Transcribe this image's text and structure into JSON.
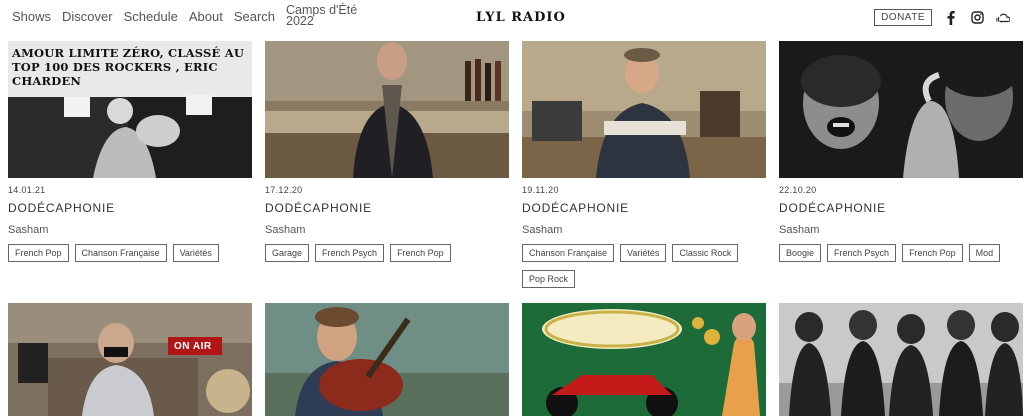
{
  "nav": {
    "shows": "Shows",
    "discover": "Discover",
    "schedule": "Schedule",
    "about": "About",
    "search": "Search",
    "camps": "Camps d'Été 2022"
  },
  "logo": "LYL RADIO",
  "donate": "DONATE",
  "social": [
    "facebook-icon",
    "instagram-icon",
    "soundcloud-icon"
  ],
  "cards": [
    {
      "date": "14.01.21",
      "title": "DODÉCAPHONIE",
      "host": "Sasham",
      "tags": [
        "French Pop",
        "Chanson Française",
        "Variétés"
      ],
      "image": {
        "headline": "AMOUR LIMITE ZÉRO, CLASSÉ AU TOP 100 DES ROCKERS , ERIC CHARDEN"
      }
    },
    {
      "date": "17.12.20",
      "title": "DODÉCAPHONIE",
      "host": "Sasham",
      "tags": [
        "Garage",
        "French Psych",
        "French Pop"
      ]
    },
    {
      "date": "19.11.20",
      "title": "DODÉCAPHONIE",
      "host": "Sasham",
      "tags": [
        "Chanson Française",
        "Variétés",
        "Classic Rock",
        "Pop Rock"
      ]
    },
    {
      "date": "22.10.20",
      "title": "DODÉCAPHONIE",
      "host": "Sasham",
      "tags": [
        "Boogie",
        "French Psych",
        "French Pop",
        "Mod"
      ]
    }
  ],
  "row2_images": {
    "onair": "ON AIR"
  }
}
